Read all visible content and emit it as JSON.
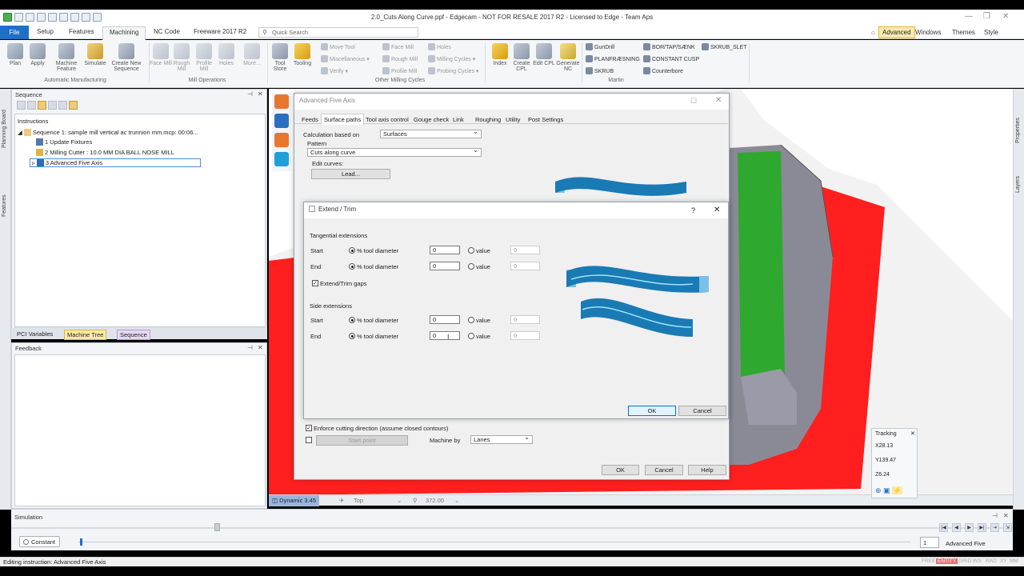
{
  "window": {
    "title": "2.0_Cuts Along Curve.ppf - Edgecam - NOT FOR RESALE 2017 R2  -  Licensed to Edge - Team Aps",
    "min": "—",
    "restore": "❐",
    "close": "✕"
  },
  "ribbon_tabs": [
    "File",
    "Setup",
    "Features",
    "Machining",
    "NC Code",
    "Freeware 2017 R2"
  ],
  "quick_search": {
    "placeholder": "Quick Search"
  },
  "ribbon_right": {
    "advanced": "Advanced",
    "windows": "Windows",
    "themes": "Themes",
    "style": "Style"
  },
  "ribbon": {
    "big": [
      "Plan",
      "Apply",
      "Machine Feature",
      "Simulate",
      "Create New Sequence",
      "Face Mill",
      "Rough Mill",
      "Profile Mill",
      "Holes",
      "More...",
      "Tool Store",
      "Tooling",
      "Index",
      "Create CPL",
      "Edit CPL",
      "Generate NC"
    ],
    "small_ops": [
      "Move Tool",
      "Miscellaneous",
      "Verify",
      "Face Mill",
      "Rough Mill",
      "Profile Mill",
      "Holes",
      "Milling Cycles",
      "Probing Cycles"
    ],
    "martin": [
      "GunDrill",
      "PLANFRÆSNING",
      "SKRUB",
      "BOR/TAP/SÆNK",
      "CONSTANT CUSP",
      "Counterbore",
      "SKRUB_SLET"
    ],
    "groups": [
      "Automatic Manufacturing",
      "Mill Operations",
      "Other Milling Cycles",
      "Martin"
    ]
  },
  "left_strip": [
    "Planning Board",
    "Features"
  ],
  "right_strip": [
    "Properties",
    "Layers"
  ],
  "sequence_panel": {
    "title": "Sequence",
    "header": "Instructions",
    "items": [
      "Sequence 1: sample mill vertical ac trunnion mm.mcp: 00:06...",
      "1 Update Fixtures",
      "2 Milling Cutter : 10.0 MM DIA BALL NOSE MILL",
      "3 Advanced Five Axis"
    ]
  },
  "panel_tabs": [
    "PCI Variables",
    "Machine Tree",
    "Sequence"
  ],
  "feedback_panel": {
    "title": "Feedback"
  },
  "view_toolbar": {
    "dynamic": "Dynamic 3.45",
    "view": "Top",
    "zoom": "372.00"
  },
  "tracking": {
    "title": "Tracking",
    "x": "X28.13",
    "y": "Y139.47",
    "z": "Z6.24"
  },
  "simulation": {
    "title": "Simulation",
    "mode_button": "Constant",
    "spin_value": "1",
    "mode": "Advanced Five"
  },
  "status": {
    "text": "Editing instruction: Advanced Five Axis",
    "indicators": [
      "FREE",
      "ENTITY",
      "GRID",
      "INS",
      "RAD",
      "XY",
      "MM"
    ]
  },
  "afa_dialog": {
    "title": "Advanced Five Axis",
    "tabs": [
      "Feeds",
      "Surface paths",
      "Tool axis control",
      "Gouge check",
      "Link",
      "Roughing",
      "Utility",
      "Post Settings"
    ],
    "calc_label": "Calculation based on",
    "calc_value": "Surfaces",
    "pattern_label": "Pattern",
    "pattern_value": "Cuts along curve",
    "edit_curves_label": "Edit curves:",
    "lead_button": "Lead...",
    "enforce_label": "Enforce cutting direction (assume closed contours)",
    "start_point_button": "Start point",
    "machine_by_label": "Machine by",
    "machine_by_value": "Lanes",
    "ok": "OK",
    "cancel": "Cancel",
    "help": "Help"
  },
  "extend_dialog": {
    "title": "Extend / Trim",
    "help": "?",
    "close": "✕",
    "tangential_label": "Tangential extensions",
    "side_label": "Side extensions",
    "start_label": "Start",
    "end_label": "End",
    "pct_label": "% tool diameter",
    "value_label": "value",
    "tan_start": "0",
    "tan_start_val": "0",
    "tan_end": "0",
    "tan_end_val": "0",
    "gaps_label": "Extend/Trim gaps",
    "side_start": "0",
    "side_start_val": "0",
    "side_end": "0",
    "side_end_val": "0",
    "ok": "OK",
    "cancel": "Cancel"
  },
  "colors": {
    "accent": "#1e6fc8",
    "stock_red": "#ff1f1f",
    "part_green": "#2ea82e",
    "part_grey": "#8a8a96",
    "surface_blue": "#1a7ab4"
  }
}
